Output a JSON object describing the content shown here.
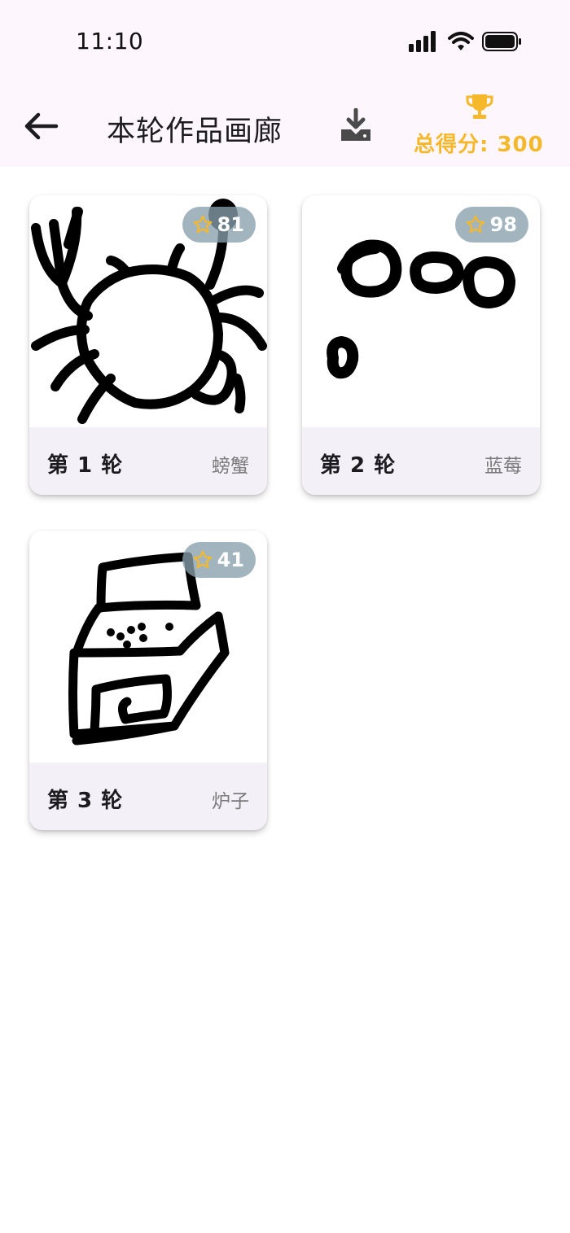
{
  "status_bar": {
    "time": "11:10"
  },
  "header": {
    "title": "本轮作品画廊",
    "score_label": "总得分: 300"
  },
  "colors": {
    "header_bg": "#fdf6fd",
    "score": "#f5b82a",
    "badge_bg": "#88a0ac",
    "card_footer_bg": "#f4f0f7"
  },
  "icons": {
    "back": "arrow-left-icon",
    "download": "download-icon",
    "trophy": "trophy-icon",
    "star": "star-outline-icon"
  },
  "gallery": [
    {
      "round": "第 1 轮",
      "word": "螃蟹",
      "score": "81"
    },
    {
      "round": "第 2 轮",
      "word": "蓝莓",
      "score": "98"
    },
    {
      "round": "第 3 轮",
      "word": "炉子",
      "score": "41"
    }
  ]
}
